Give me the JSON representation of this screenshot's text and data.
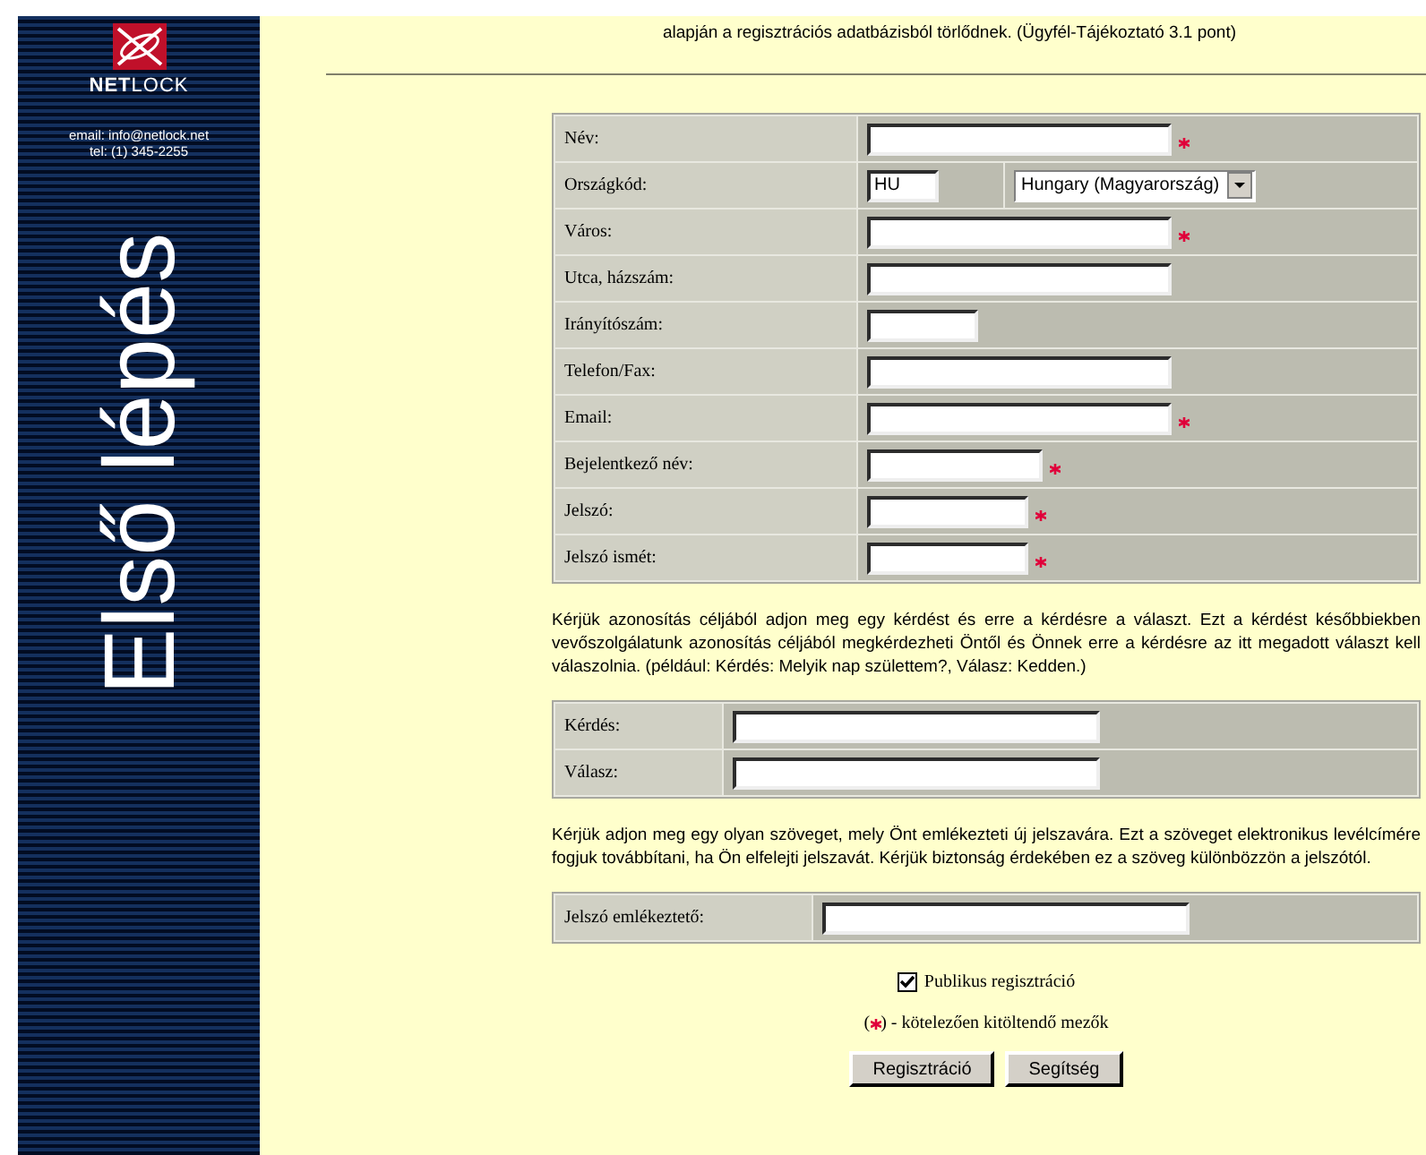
{
  "sidebar": {
    "logo_bold": "NET",
    "logo_light": "LOCK",
    "email": "email: info@netlock.net",
    "phone": "tel: (1) 345-2255",
    "title": "Első lépés"
  },
  "intro": "alapján a regisztrációs adatbázisból törlődnek. (Ügyfél-Tájékoztató 3.1 pont)",
  "main_form": [
    {
      "kind": "text",
      "label": "Név:",
      "required": true
    },
    {
      "kind": "country",
      "label": "Országkód:",
      "value": "HU",
      "country": "Hungary (Magyarország)"
    },
    {
      "kind": "text",
      "label": "Város:",
      "required": true
    },
    {
      "kind": "text",
      "label": "Utca, házszám:",
      "required": false
    },
    {
      "kind": "zip",
      "label": "Irányítószám:",
      "required": false
    },
    {
      "kind": "text",
      "label": "Telefon/Fax:",
      "required": false
    },
    {
      "kind": "text",
      "label": "Email:",
      "required": true
    },
    {
      "kind": "login",
      "label": "Bejelentkező név:",
      "required": true
    },
    {
      "kind": "password",
      "label": "Jelszó:",
      "required": true
    },
    {
      "kind": "password",
      "label": "Jelszó ismét:",
      "required": true
    }
  ],
  "question_note": "Kérjük azonosítás céljából adjon meg egy kérdést és erre a kérdésre a választ. Ezt a kérdést későbbiekben vevőszolgálatunk azonosítás céljából megkérdezheti Öntől és Önnek erre a kérdésre az itt megadott választ kell válaszolnia. (például: Kérdés: Melyik nap születtem?, Válasz: Kedden.)",
  "question_form": [
    {
      "label": "Kérdés:"
    },
    {
      "label": "Válasz:"
    }
  ],
  "reminder_note": "Kérjük adjon meg egy olyan szöveget, mely Önt emlékezteti új jelszavára. Ezt a szöveget elektronikus levélcímére fogjuk továbbítani, ha Ön elfelejti jelszavát. Kérjük biztonság érdekében ez a szöveg különbözzön a jelszótól.",
  "reminder_form": {
    "label": "Jelszó emlékeztető:"
  },
  "public_checkbox": {
    "label": "Publikus regisztráció",
    "checked": true
  },
  "legend": {
    "before": "(",
    "after": ") - kötelezően kitöltendő mezők"
  },
  "buttons": [
    "Regisztráció",
    "Segítség"
  ]
}
